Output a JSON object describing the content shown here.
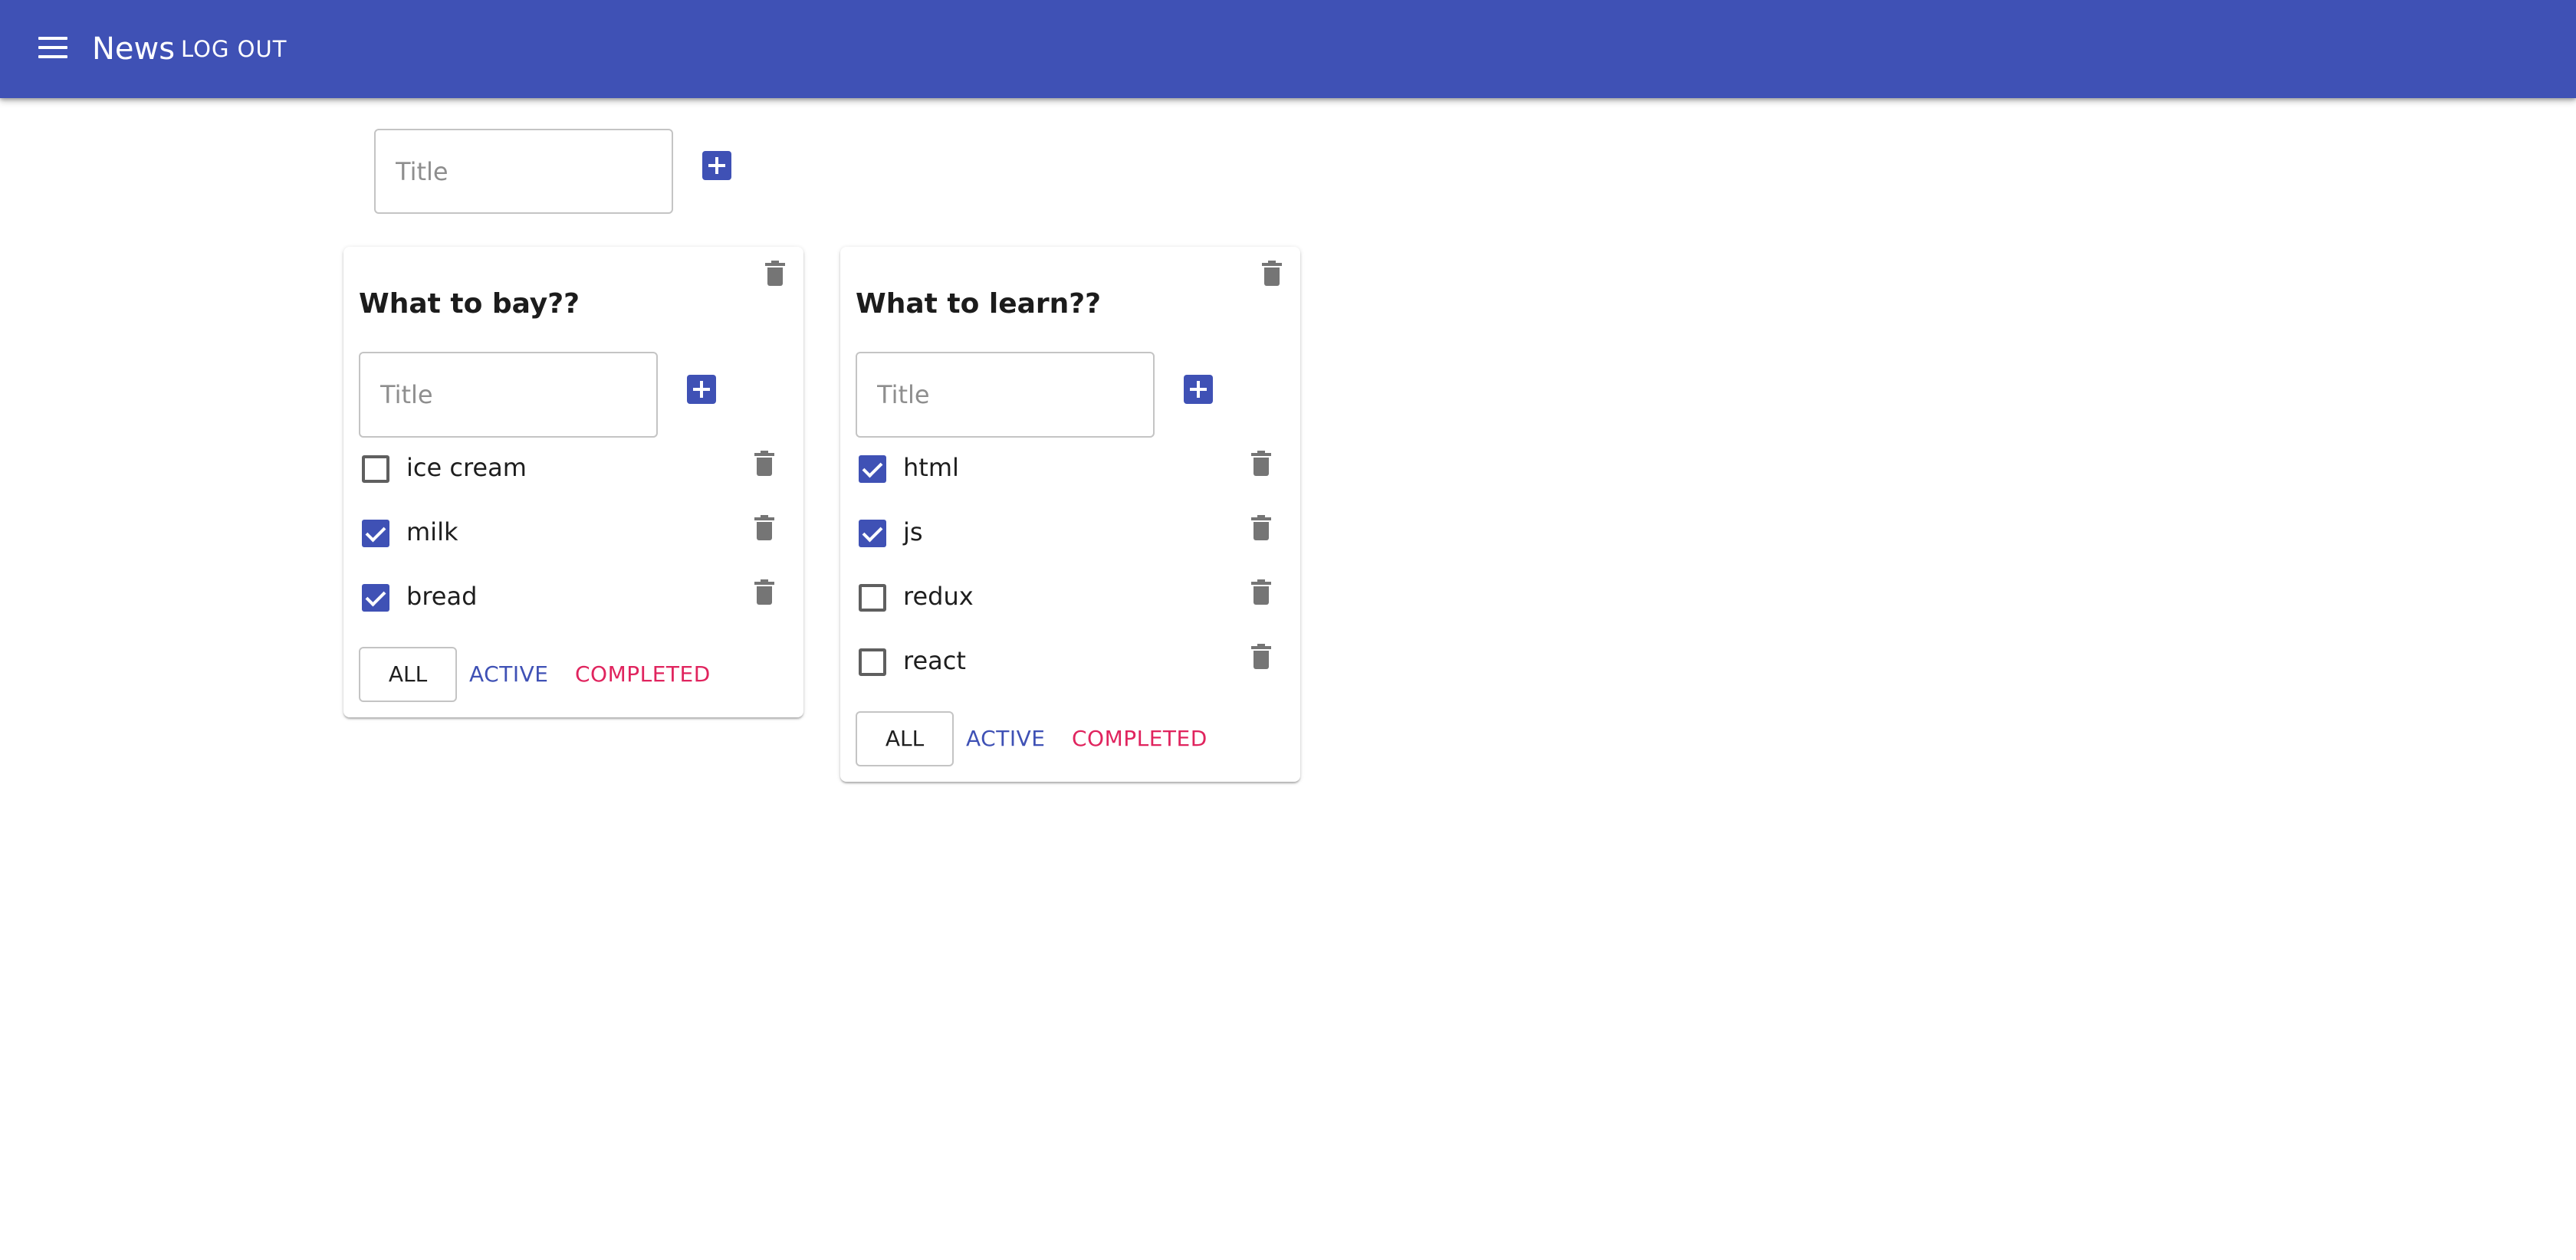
{
  "header": {
    "title": "News",
    "logout_label": "LOG OUT",
    "menu_icon": "menu-icon",
    "background_color": "#3f51b5"
  },
  "new_list": {
    "placeholder": "Title",
    "value": "",
    "add_icon": "add-box-icon"
  },
  "lists": [
    {
      "title": "What to bay??",
      "input_placeholder": "Title",
      "tasks": [
        {
          "label": "ice cream",
          "checked": false
        },
        {
          "label": "milk",
          "checked": true
        },
        {
          "label": "bread",
          "checked": true
        }
      ],
      "filters": {
        "all": "ALL",
        "active": "ACTIVE",
        "completed": "COMPLETED"
      }
    },
    {
      "title": "What to learn??",
      "input_placeholder": "Title",
      "tasks": [
        {
          "label": "html",
          "checked": true
        },
        {
          "label": "js",
          "checked": true
        },
        {
          "label": "redux",
          "checked": false
        },
        {
          "label": "react",
          "checked": false
        }
      ],
      "filters": {
        "all": "ALL",
        "active": "ACTIVE",
        "completed": "COMPLETED"
      }
    }
  ],
  "colors": {
    "primary": "#3f51b5",
    "secondary": "#e0245e",
    "icon_gray": "#757575"
  }
}
